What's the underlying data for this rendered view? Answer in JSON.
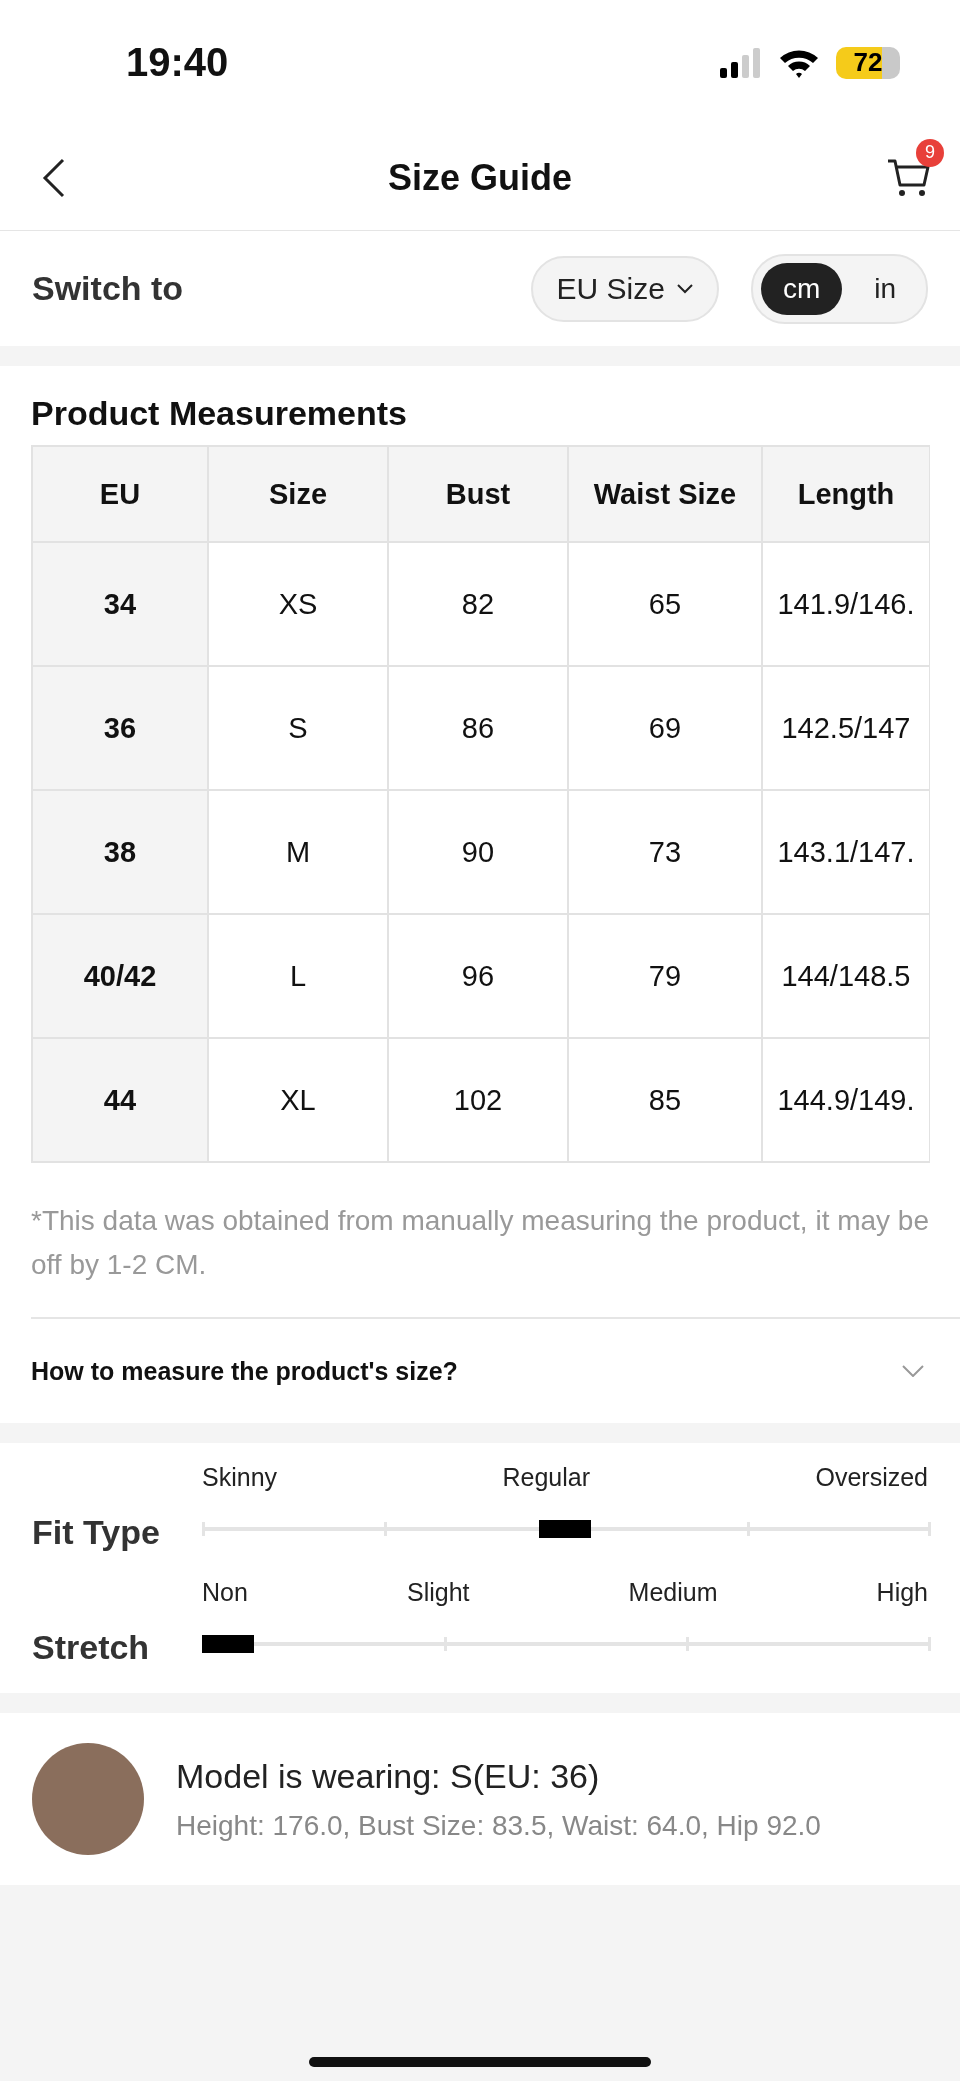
{
  "status_bar": {
    "time": "19:40",
    "battery": "72"
  },
  "nav": {
    "title": "Size Guide",
    "cart_count": "9"
  },
  "switch": {
    "label": "Switch to",
    "size_system": "EU Size",
    "units": [
      {
        "label": "cm",
        "selected": true
      },
      {
        "label": "in",
        "selected": false
      }
    ]
  },
  "measurements": {
    "title": "Product Measurements",
    "columns": [
      "EU",
      "Size",
      "Bust",
      "Waist Size",
      "Length"
    ],
    "rows": [
      [
        "34",
        "XS",
        "82",
        "65",
        "141.9/146."
      ],
      [
        "36",
        "S",
        "86",
        "69",
        "142.5/147"
      ],
      [
        "38",
        "M",
        "90",
        "73",
        "143.1/147."
      ],
      [
        "40/42",
        "L",
        "96",
        "79",
        "144/148.5"
      ],
      [
        "44",
        "XL",
        "102",
        "85",
        "144.9/149."
      ]
    ],
    "note": "*This data was obtained from manually measuring the product, it may be off by 1-2 CM.",
    "how_to": "How to measure the product's size?"
  },
  "scales": [
    {
      "kind": "fit",
      "label": "Fit Type",
      "ticks": [
        {
          "label": "Skinny",
          "selected": false
        },
        {
          "label": "Regular",
          "selected": true
        },
        {
          "label": "Oversized",
          "selected": false
        }
      ]
    },
    {
      "kind": "stretch",
      "label": "Stretch",
      "ticks": [
        {
          "label": "Non",
          "selected": true
        },
        {
          "label": "Slight",
          "selected": false
        },
        {
          "label": "Medium",
          "selected": false
        },
        {
          "label": "High",
          "selected": false
        }
      ]
    }
  ],
  "model": {
    "wearing": "Model is wearing: S(EU: 36)",
    "details": "Height: 176.0, Bust Size: 83.5, Waist: 64.0, Hip 92.0"
  }
}
